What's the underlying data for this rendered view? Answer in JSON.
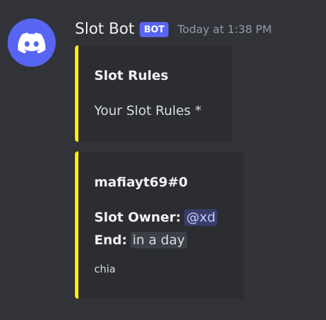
{
  "message": {
    "username": "Slot Bot",
    "bot_tag": "BOT",
    "timestamp": "Today at 1:38 PM",
    "avatar_icon": "discord-logo-icon"
  },
  "embeds": [
    {
      "accent_color": "#fff000",
      "title": "Slot Rules",
      "description": "Your Slot Rules *"
    },
    {
      "accent_color": "#fff000",
      "title": "mafiayt69#0",
      "fields": [
        {
          "name": "Slot Owner:",
          "value": "@xd"
        },
        {
          "name": "End:",
          "value": "in a day"
        }
      ],
      "footer": "chia"
    }
  ],
  "colors": {
    "background": "#313338",
    "embed_background": "#2b2d31",
    "bot_tag": "#5865f2",
    "mention_text": "#c9cdfb"
  }
}
